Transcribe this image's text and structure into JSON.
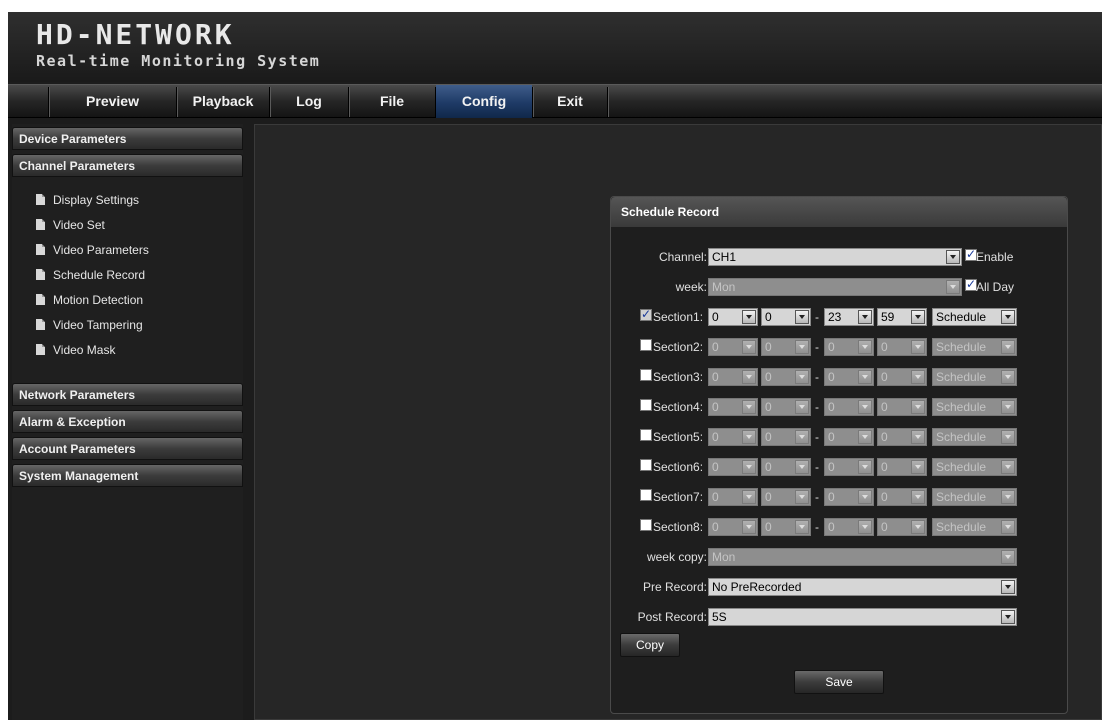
{
  "header": {
    "brand": "HD-NETWORK",
    "subtitle": "Real-time Monitoring System"
  },
  "nav": {
    "tabs": [
      "Preview",
      "Playback",
      "Log",
      "File",
      "Config",
      "Exit"
    ],
    "active": "Config"
  },
  "sidebar": {
    "device": "Device Parameters",
    "channel": "Channel Parameters",
    "channel_items": [
      "Display Settings",
      "Video Set",
      "Video Parameters",
      "Schedule Record",
      "Motion Detection",
      "Video Tampering",
      "Video Mask"
    ],
    "network": "Network Parameters",
    "alarm": "Alarm & Exception",
    "account": "Account Parameters",
    "system": "System Management"
  },
  "panel": {
    "title": "Schedule Record",
    "channel_label": "Channel:",
    "channel_value": "CH1",
    "enable_label": "Enable",
    "enable_checked": true,
    "week_label": "week:",
    "week_value": "Mon",
    "allday_label": "All Day",
    "allday_checked": true,
    "sections": [
      {
        "label": "Section1:",
        "checked": true,
        "start_h": "0",
        "start_m": "0",
        "end_h": "23",
        "end_m": "59",
        "mode": "Schedule"
      },
      {
        "label": "Section2:",
        "checked": false,
        "start_h": "0",
        "start_m": "0",
        "end_h": "0",
        "end_m": "0",
        "mode": "Schedule"
      },
      {
        "label": "Section3:",
        "checked": false,
        "start_h": "0",
        "start_m": "0",
        "end_h": "0",
        "end_m": "0",
        "mode": "Schedule"
      },
      {
        "label": "Section4:",
        "checked": false,
        "start_h": "0",
        "start_m": "0",
        "end_h": "0",
        "end_m": "0",
        "mode": "Schedule"
      },
      {
        "label": "Section5:",
        "checked": false,
        "start_h": "0",
        "start_m": "0",
        "end_h": "0",
        "end_m": "0",
        "mode": "Schedule"
      },
      {
        "label": "Section6:",
        "checked": false,
        "start_h": "0",
        "start_m": "0",
        "end_h": "0",
        "end_m": "0",
        "mode": "Schedule"
      },
      {
        "label": "Section7:",
        "checked": false,
        "start_h": "0",
        "start_m": "0",
        "end_h": "0",
        "end_m": "0",
        "mode": "Schedule"
      },
      {
        "label": "Section8:",
        "checked": false,
        "start_h": "0",
        "start_m": "0",
        "end_h": "0",
        "end_m": "0",
        "mode": "Schedule"
      }
    ],
    "dash": "-",
    "weekcopy_label": "week copy:",
    "weekcopy_value": "Mon",
    "prerecord_label": "Pre Record:",
    "prerecord_value": "No PreRecorded",
    "postrecord_label": "Post Record:",
    "postrecord_value": "5S",
    "copy_button": "Copy",
    "save_button": "Save"
  }
}
